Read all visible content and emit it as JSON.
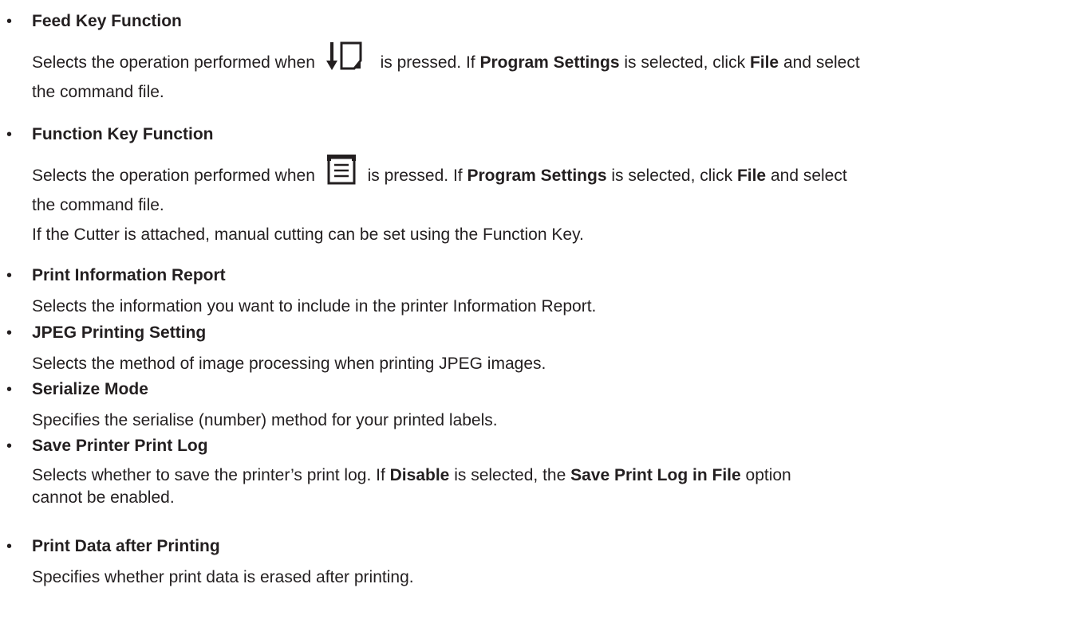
{
  "sections": [
    {
      "title": "Feed Key Function",
      "body": {
        "pre": "Selects the operation performed when",
        "icon": "feed-key-icon",
        "mid1": "is pressed. If",
        "bold1": "Program Settings",
        "mid2": "is selected, click",
        "bold2": "File",
        "post": "and select",
        "line2": "the command file."
      }
    },
    {
      "title": "Function Key Function",
      "body": {
        "pre": "Selects the operation performed when",
        "icon": "function-key-icon",
        "mid1": "is pressed. If",
        "bold1": "Program Settings",
        "mid2": "is selected, click",
        "bold2": "File",
        "post": "and select",
        "line2": "the command file.",
        "note": "If the Cutter is attached, manual cutting can be set using the Function Key."
      }
    },
    {
      "title": "Print Information Report",
      "body": "Selects the information you want to include in the printer Information Report."
    },
    {
      "title": "JPEG Printing Setting",
      "body": "Selects the method of image processing when printing JPEG images."
    },
    {
      "title": "Serialize Mode",
      "body": "Specifies the serialise (number) method for your printed labels."
    },
    {
      "title": "Save Printer Print Log",
      "body": {
        "pre": "Selects whether to save the printer’s print log. If",
        "bold1": "Disable",
        "mid": "is selected, the",
        "bold2": "Save Print Log in File",
        "post": "option",
        "line2": "cannot be enabled."
      }
    },
    {
      "title": "Print Data after Printing",
      "body": "Specifies whether print data is erased after printing."
    }
  ],
  "bullet_char": "•"
}
